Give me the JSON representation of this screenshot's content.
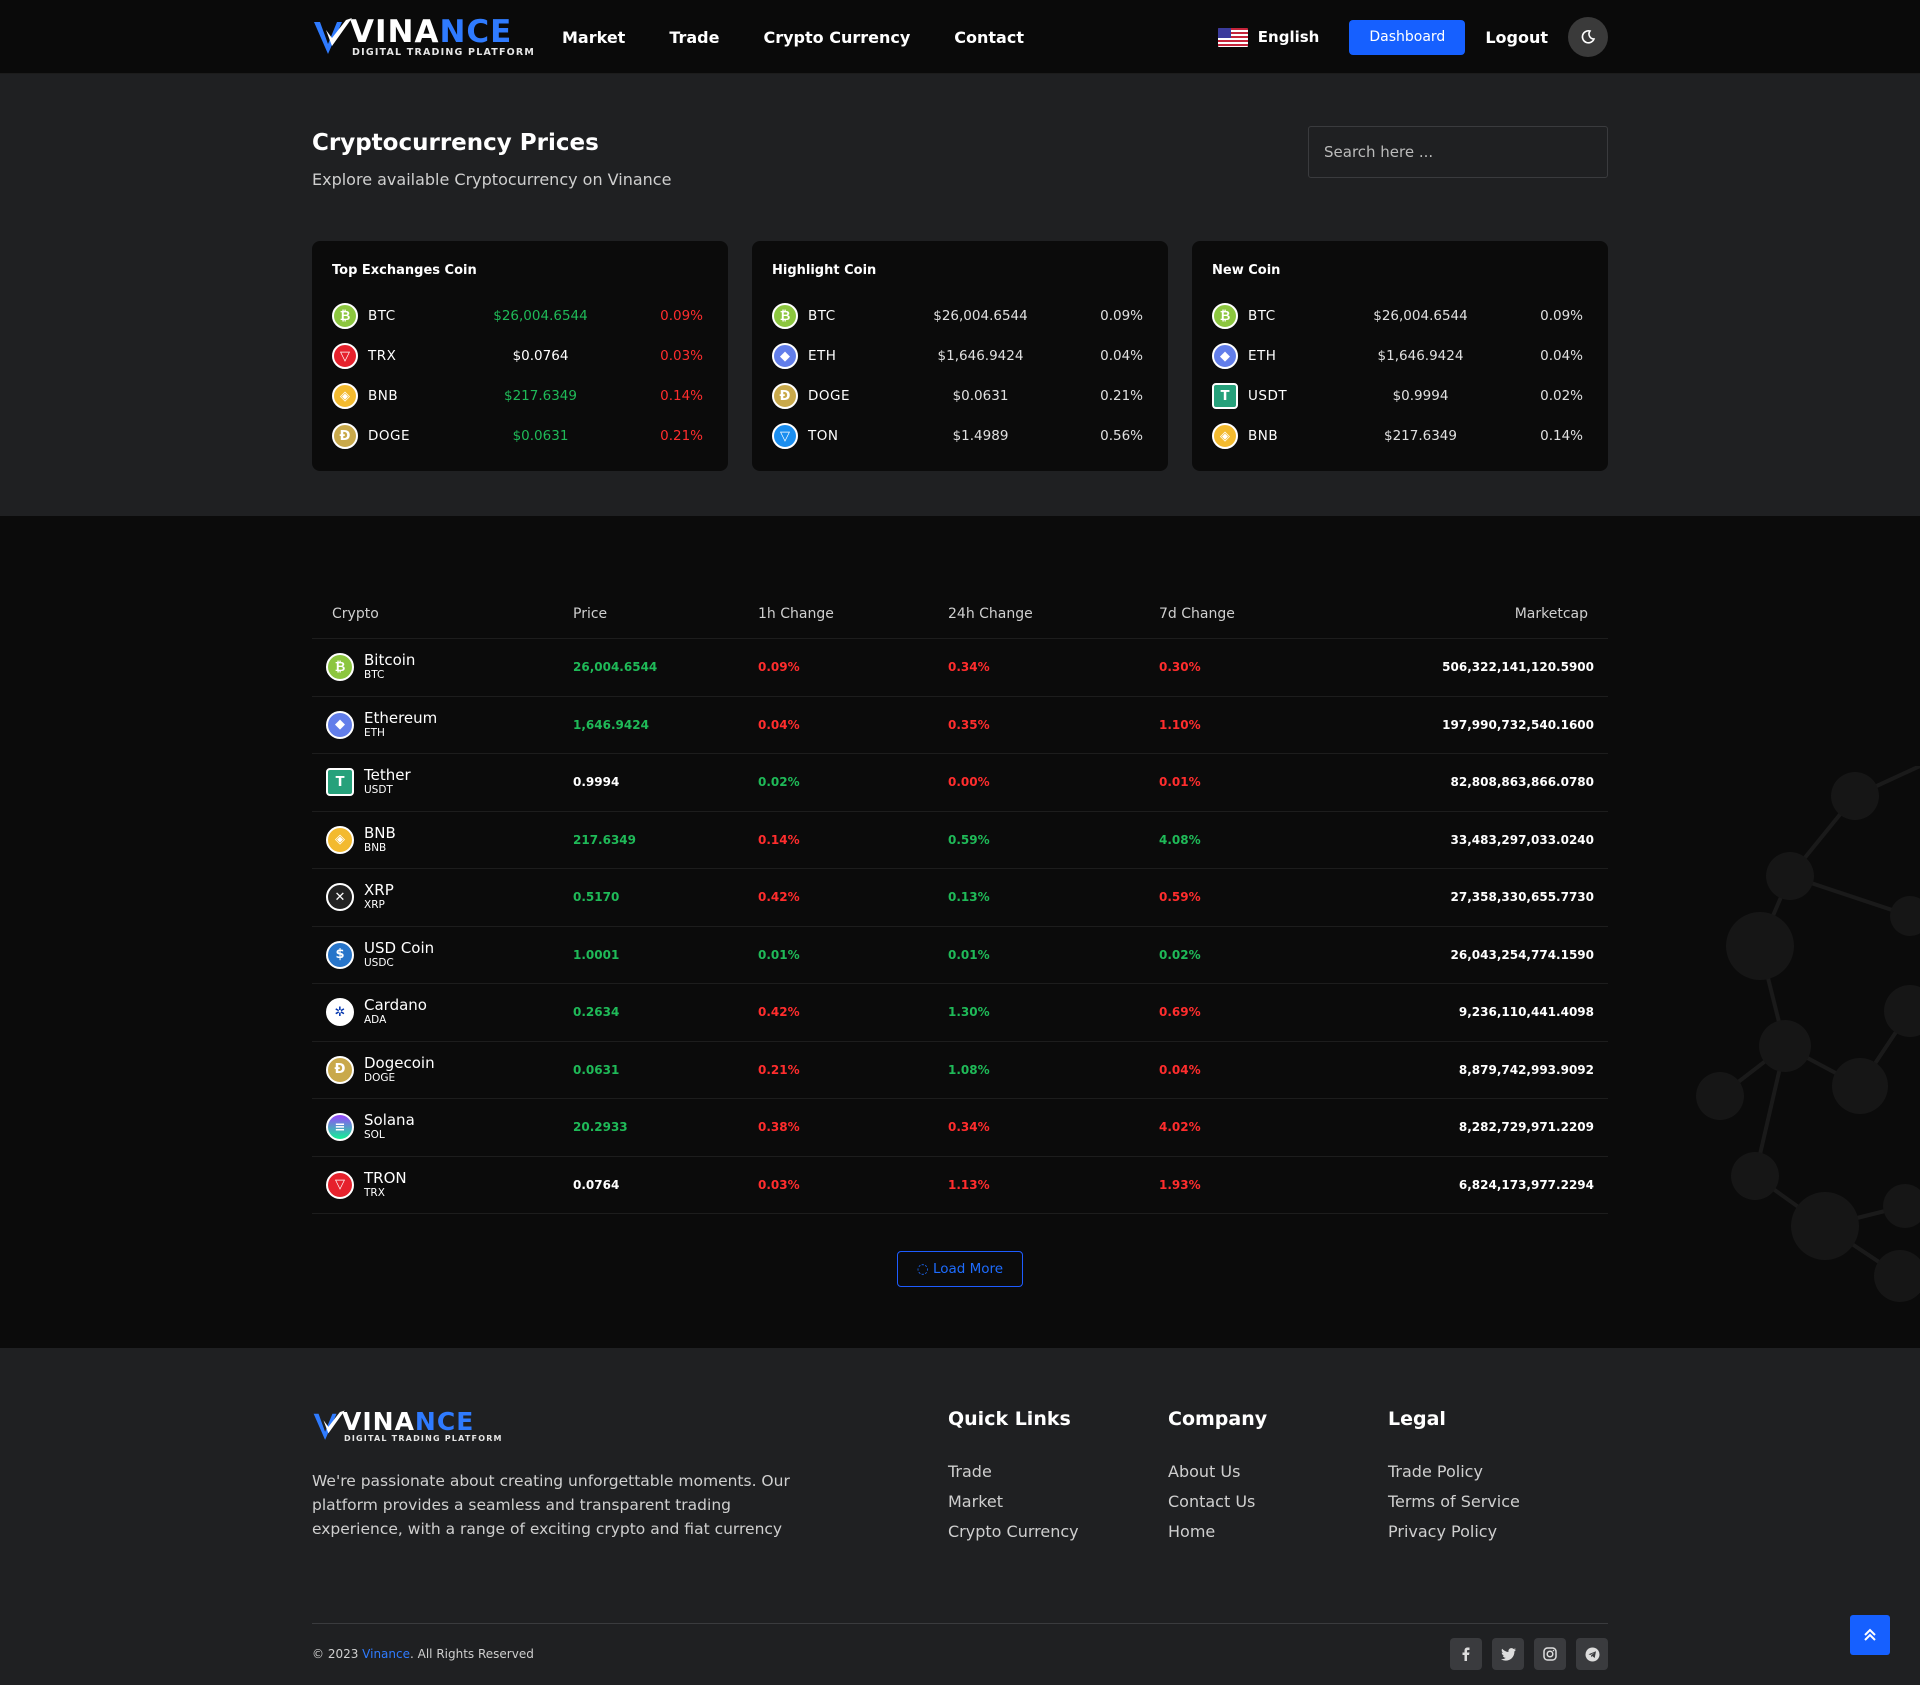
{
  "brand": {
    "word_a": "VINA",
    "word_b": "NCE",
    "tagline": "DIGITAL TRADING PLATFORM"
  },
  "nav": {
    "items": [
      "Market",
      "Trade",
      "Crypto Currency",
      "Contact"
    ],
    "language": "English",
    "dashboard_label": "Dashboard",
    "logout_label": "Logout"
  },
  "hero": {
    "title": "Cryptocurrency Prices",
    "subtitle": "Explore available Cryptocurrency on Vinance",
    "search_placeholder": "Search here ..."
  },
  "cards": [
    {
      "title": "Top Exchanges Coin",
      "rows": [
        {
          "icon": "btc",
          "glyph": "₿",
          "symbol": "BTC",
          "price": "$26,004.6544",
          "change": "0.09%",
          "price_color": "green",
          "change_color": "red"
        },
        {
          "icon": "trx",
          "glyph": "▽",
          "symbol": "TRX",
          "price": "$0.0764",
          "change": "0.03%",
          "price_color": "white",
          "change_color": "red"
        },
        {
          "icon": "bnb",
          "glyph": "◈",
          "symbol": "BNB",
          "price": "$217.6349",
          "change": "0.14%",
          "price_color": "green",
          "change_color": "red"
        },
        {
          "icon": "doge",
          "glyph": "Ð",
          "symbol": "DOGE",
          "price": "$0.0631",
          "change": "0.21%",
          "price_color": "green",
          "change_color": "red"
        }
      ]
    },
    {
      "title": "Highlight Coin",
      "rows": [
        {
          "icon": "btc",
          "glyph": "₿",
          "symbol": "BTC",
          "price": "$26,004.6544",
          "change": "0.09%",
          "price_color": "grey",
          "change_color": "grey"
        },
        {
          "icon": "eth",
          "glyph": "◆",
          "symbol": "ETH",
          "price": "$1,646.9424",
          "change": "0.04%",
          "price_color": "grey",
          "change_color": "grey"
        },
        {
          "icon": "doge",
          "glyph": "Ð",
          "symbol": "DOGE",
          "price": "$0.0631",
          "change": "0.21%",
          "price_color": "grey",
          "change_color": "grey"
        },
        {
          "icon": "ton",
          "glyph": "▽",
          "symbol": "TON",
          "price": "$1.4989",
          "change": "0.56%",
          "price_color": "grey",
          "change_color": "grey"
        }
      ]
    },
    {
      "title": "New Coin",
      "rows": [
        {
          "icon": "btc",
          "glyph": "₿",
          "symbol": "BTC",
          "price": "$26,004.6544",
          "change": "0.09%",
          "price_color": "grey",
          "change_color": "grey"
        },
        {
          "icon": "eth",
          "glyph": "◆",
          "symbol": "ETH",
          "price": "$1,646.9424",
          "change": "0.04%",
          "price_color": "grey",
          "change_color": "grey"
        },
        {
          "icon": "usdt",
          "glyph": "T",
          "symbol": "USDT",
          "price": "$0.9994",
          "change": "0.02%",
          "price_color": "grey",
          "change_color": "grey"
        },
        {
          "icon": "bnb",
          "glyph": "◈",
          "symbol": "BNB",
          "price": "$217.6349",
          "change": "0.14%",
          "price_color": "grey",
          "change_color": "grey"
        }
      ]
    }
  ],
  "table": {
    "headers": [
      "Crypto",
      "Price",
      "1h Change",
      "24h Change",
      "7d Change",
      "Marketcap"
    ],
    "rows": [
      {
        "icon": "btc",
        "glyph": "₿",
        "name": "Bitcoin",
        "abbr": "BTC",
        "price": "26,004.6544",
        "p_c": "green",
        "h1": "0.09%",
        "h1_c": "red",
        "h24": "0.34%",
        "h24_c": "red",
        "d7": "0.30%",
        "d7_c": "red",
        "mcap": "506,322,141,120.5900"
      },
      {
        "icon": "eth",
        "glyph": "◆",
        "name": "Ethereum",
        "abbr": "ETH",
        "price": "1,646.9424",
        "p_c": "green",
        "h1": "0.04%",
        "h1_c": "red",
        "h24": "0.35%",
        "h24_c": "red",
        "d7": "1.10%",
        "d7_c": "red",
        "mcap": "197,990,732,540.1600"
      },
      {
        "icon": "usdt",
        "glyph": "T",
        "name": "Tether",
        "abbr": "USDT",
        "price": "0.9994",
        "p_c": "white",
        "h1": "0.02%",
        "h1_c": "green",
        "h24": "0.00%",
        "h24_c": "red",
        "d7": "0.01%",
        "d7_c": "red",
        "mcap": "82,808,863,866.0780"
      },
      {
        "icon": "bnb",
        "glyph": "◈",
        "name": "BNB",
        "abbr": "BNB",
        "price": "217.6349",
        "p_c": "green",
        "h1": "0.14%",
        "h1_c": "red",
        "h24": "0.59%",
        "h24_c": "green",
        "d7": "4.08%",
        "d7_c": "green",
        "mcap": "33,483,297,033.0240"
      },
      {
        "icon": "xrp",
        "glyph": "✕",
        "name": "XRP",
        "abbr": "XRP",
        "price": "0.5170",
        "p_c": "green",
        "h1": "0.42%",
        "h1_c": "red",
        "h24": "0.13%",
        "h24_c": "green",
        "d7": "0.59%",
        "d7_c": "red",
        "mcap": "27,358,330,655.7730"
      },
      {
        "icon": "usdc",
        "glyph": "$",
        "name": "USD Coin",
        "abbr": "USDC",
        "price": "1.0001",
        "p_c": "green",
        "h1": "0.01%",
        "h1_c": "green",
        "h24": "0.01%",
        "h24_c": "green",
        "d7": "0.02%",
        "d7_c": "green",
        "mcap": "26,043,254,774.1590"
      },
      {
        "icon": "ada",
        "glyph": "✲",
        "name": "Cardano",
        "abbr": "ADA",
        "price": "0.2634",
        "p_c": "green",
        "h1": "0.42%",
        "h1_c": "red",
        "h24": "1.30%",
        "h24_c": "green",
        "d7": "0.69%",
        "d7_c": "red",
        "mcap": "9,236,110,441.4098"
      },
      {
        "icon": "doge",
        "glyph": "Ð",
        "name": "Dogecoin",
        "abbr": "DOGE",
        "price": "0.0631",
        "p_c": "green",
        "h1": "0.21%",
        "h1_c": "red",
        "h24": "1.08%",
        "h24_c": "green",
        "d7": "0.04%",
        "d7_c": "red",
        "mcap": "8,879,742,993.9092"
      },
      {
        "icon": "sol",
        "glyph": "≡",
        "name": "Solana",
        "abbr": "SOL",
        "price": "20.2933",
        "p_c": "green",
        "h1": "0.38%",
        "h1_c": "red",
        "h24": "0.34%",
        "h24_c": "red",
        "d7": "4.02%",
        "d7_c": "red",
        "mcap": "8,282,729,971.2209"
      },
      {
        "icon": "trx",
        "glyph": "▽",
        "name": "TRON",
        "abbr": "TRX",
        "price": "0.0764",
        "p_c": "white",
        "h1": "0.03%",
        "h1_c": "red",
        "h24": "1.13%",
        "h24_c": "red",
        "d7": "1.93%",
        "d7_c": "red",
        "mcap": "6,824,173,977.2294"
      }
    ],
    "load_more_label": "Load More"
  },
  "footer": {
    "about": "We're passionate about creating unforgettable moments. Our platform provides a seamless and transparent trading experience, with a range of exciting crypto and fiat currency",
    "columns": [
      {
        "title": "Quick Links",
        "links": [
          "Trade",
          "Market",
          "Crypto Currency"
        ]
      },
      {
        "title": "Company",
        "links": [
          "About Us",
          "Contact Us",
          "Home"
        ]
      },
      {
        "title": "Legal",
        "links": [
          "Trade Policy",
          "Terms of Service",
          "Privacy Policy"
        ]
      }
    ],
    "copy_prefix": "© 2023 ",
    "copy_brand": "Vinance",
    "copy_suffix": ". All Rights Reserved",
    "socials": [
      "facebook-icon",
      "twitter-icon",
      "instagram-icon",
      "telegram-icon"
    ]
  },
  "colors": {
    "accent": "#1660ff",
    "green": "#1fba58",
    "red": "#ff2d2d",
    "bg_hero": "#1f2022",
    "bg_table": "#0b0b0b"
  }
}
